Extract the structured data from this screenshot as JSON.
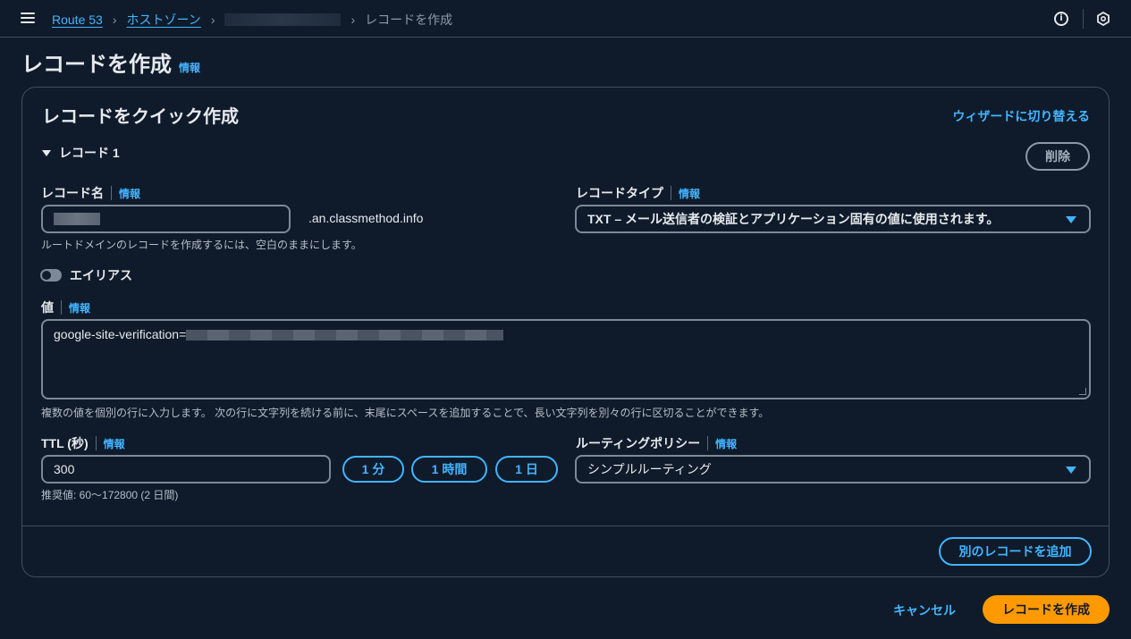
{
  "topbar": {
    "breadcrumbs": [
      {
        "label": "Route 53"
      },
      {
        "label": "ホストゾーン"
      },
      {
        "label": ""
      },
      {
        "label": "レコードを作成"
      }
    ]
  },
  "page": {
    "title": "レコードを作成",
    "info": "情報"
  },
  "panel": {
    "title": "レコードをクイック作成",
    "wizard_link": "ウィザードに切り替える",
    "record_heading": "レコード 1",
    "delete_button": "削除",
    "record_name": {
      "label": "レコード名",
      "info": "情報",
      "value": "",
      "suffix": ".an.classmethod.info",
      "hint": "ルートドメインのレコードを作成するには、空白のままにします。"
    },
    "record_type": {
      "label": "レコードタイプ",
      "info": "情報",
      "selected": "TXT – メール送信者の検証とアプリケーション固有の値に使用されます。"
    },
    "alias": {
      "label": "エイリアス",
      "enabled": false
    },
    "value": {
      "label": "値",
      "info": "情報",
      "text": "google-site-verification=",
      "hint": "複数の値を個別の行に入力します。 次の行に文字列を続ける前に、末尾にスペースを追加することで、長い文字列を別々の行に区切ることができます。"
    },
    "ttl": {
      "label": "TTL (秒)",
      "info": "情報",
      "value": "300",
      "hint": "推奨値: 60～172800 (2 日間)",
      "presets": [
        "1 分",
        "1 時間",
        "1 日"
      ]
    },
    "routing": {
      "label": "ルーティングポリシー",
      "info": "情報",
      "selected": "シンプルルーティング"
    },
    "add_record_button": "別のレコードを追加"
  },
  "actions": {
    "cancel": "キャンセル",
    "create": "レコードを作成"
  },
  "colors": {
    "background": "#0f1b2a",
    "link": "#42b4ff",
    "primary": "#ff9900",
    "border": "#414d5c"
  }
}
